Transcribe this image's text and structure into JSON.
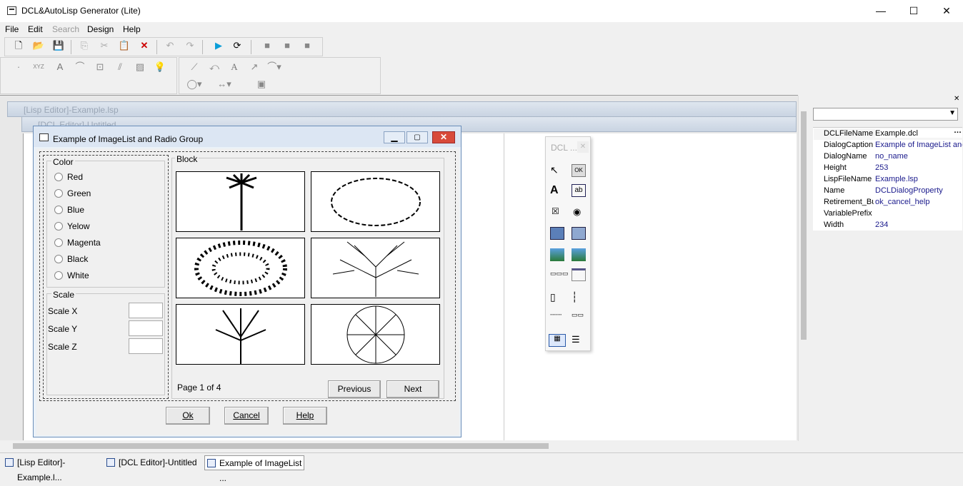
{
  "app": {
    "title": "DCL&AutoLisp Generator (Lite)"
  },
  "window_controls": {
    "minimize": "—",
    "maximize": "☐",
    "close": "✕"
  },
  "menu": [
    "File",
    "Edit",
    "Search",
    "Design",
    "Help"
  ],
  "mdi": {
    "lisp_editor": "[Lisp Editor]-Example.lsp",
    "dcl_editor": "[DCL Editor]-Untitled"
  },
  "dialog": {
    "title": "Example of ImageList and Radio Group",
    "color_group": "Color",
    "colors": [
      "Red",
      "Green",
      "Blue",
      "Yelow",
      "Magenta",
      "Black",
      "White"
    ],
    "scale_group": "Scale",
    "scales": [
      "Scale X",
      "Scale Y",
      "Scale Z"
    ],
    "block_group": "Block",
    "page": "Page 1 of 4",
    "previous": "Previous",
    "next": "Next",
    "ok": "Ok",
    "cancel": "Cancel",
    "help": "Help"
  },
  "palette": {
    "title": "DCL ...",
    "ok_label": "OK"
  },
  "properties": [
    {
      "k": "DCLFileName",
      "v": "Example.dcl"
    },
    {
      "k": "DialogCaption",
      "v": "Example of ImageList and"
    },
    {
      "k": "DialogName",
      "v": "no_name"
    },
    {
      "k": "Height",
      "v": "253"
    },
    {
      "k": "LispFileName",
      "v": "Example.lsp"
    },
    {
      "k": "Name",
      "v": "DCLDialogProperty"
    },
    {
      "k": "Retirement_Bu",
      "v": "ok_cancel_help"
    },
    {
      "k": "VariablePrefix",
      "v": ""
    },
    {
      "k": "Width",
      "v": "234"
    }
  ],
  "taskbar": [
    "[Lisp Editor]-Example.l...",
    "[DCL Editor]-Untitled",
    "Example of ImageList ..."
  ]
}
